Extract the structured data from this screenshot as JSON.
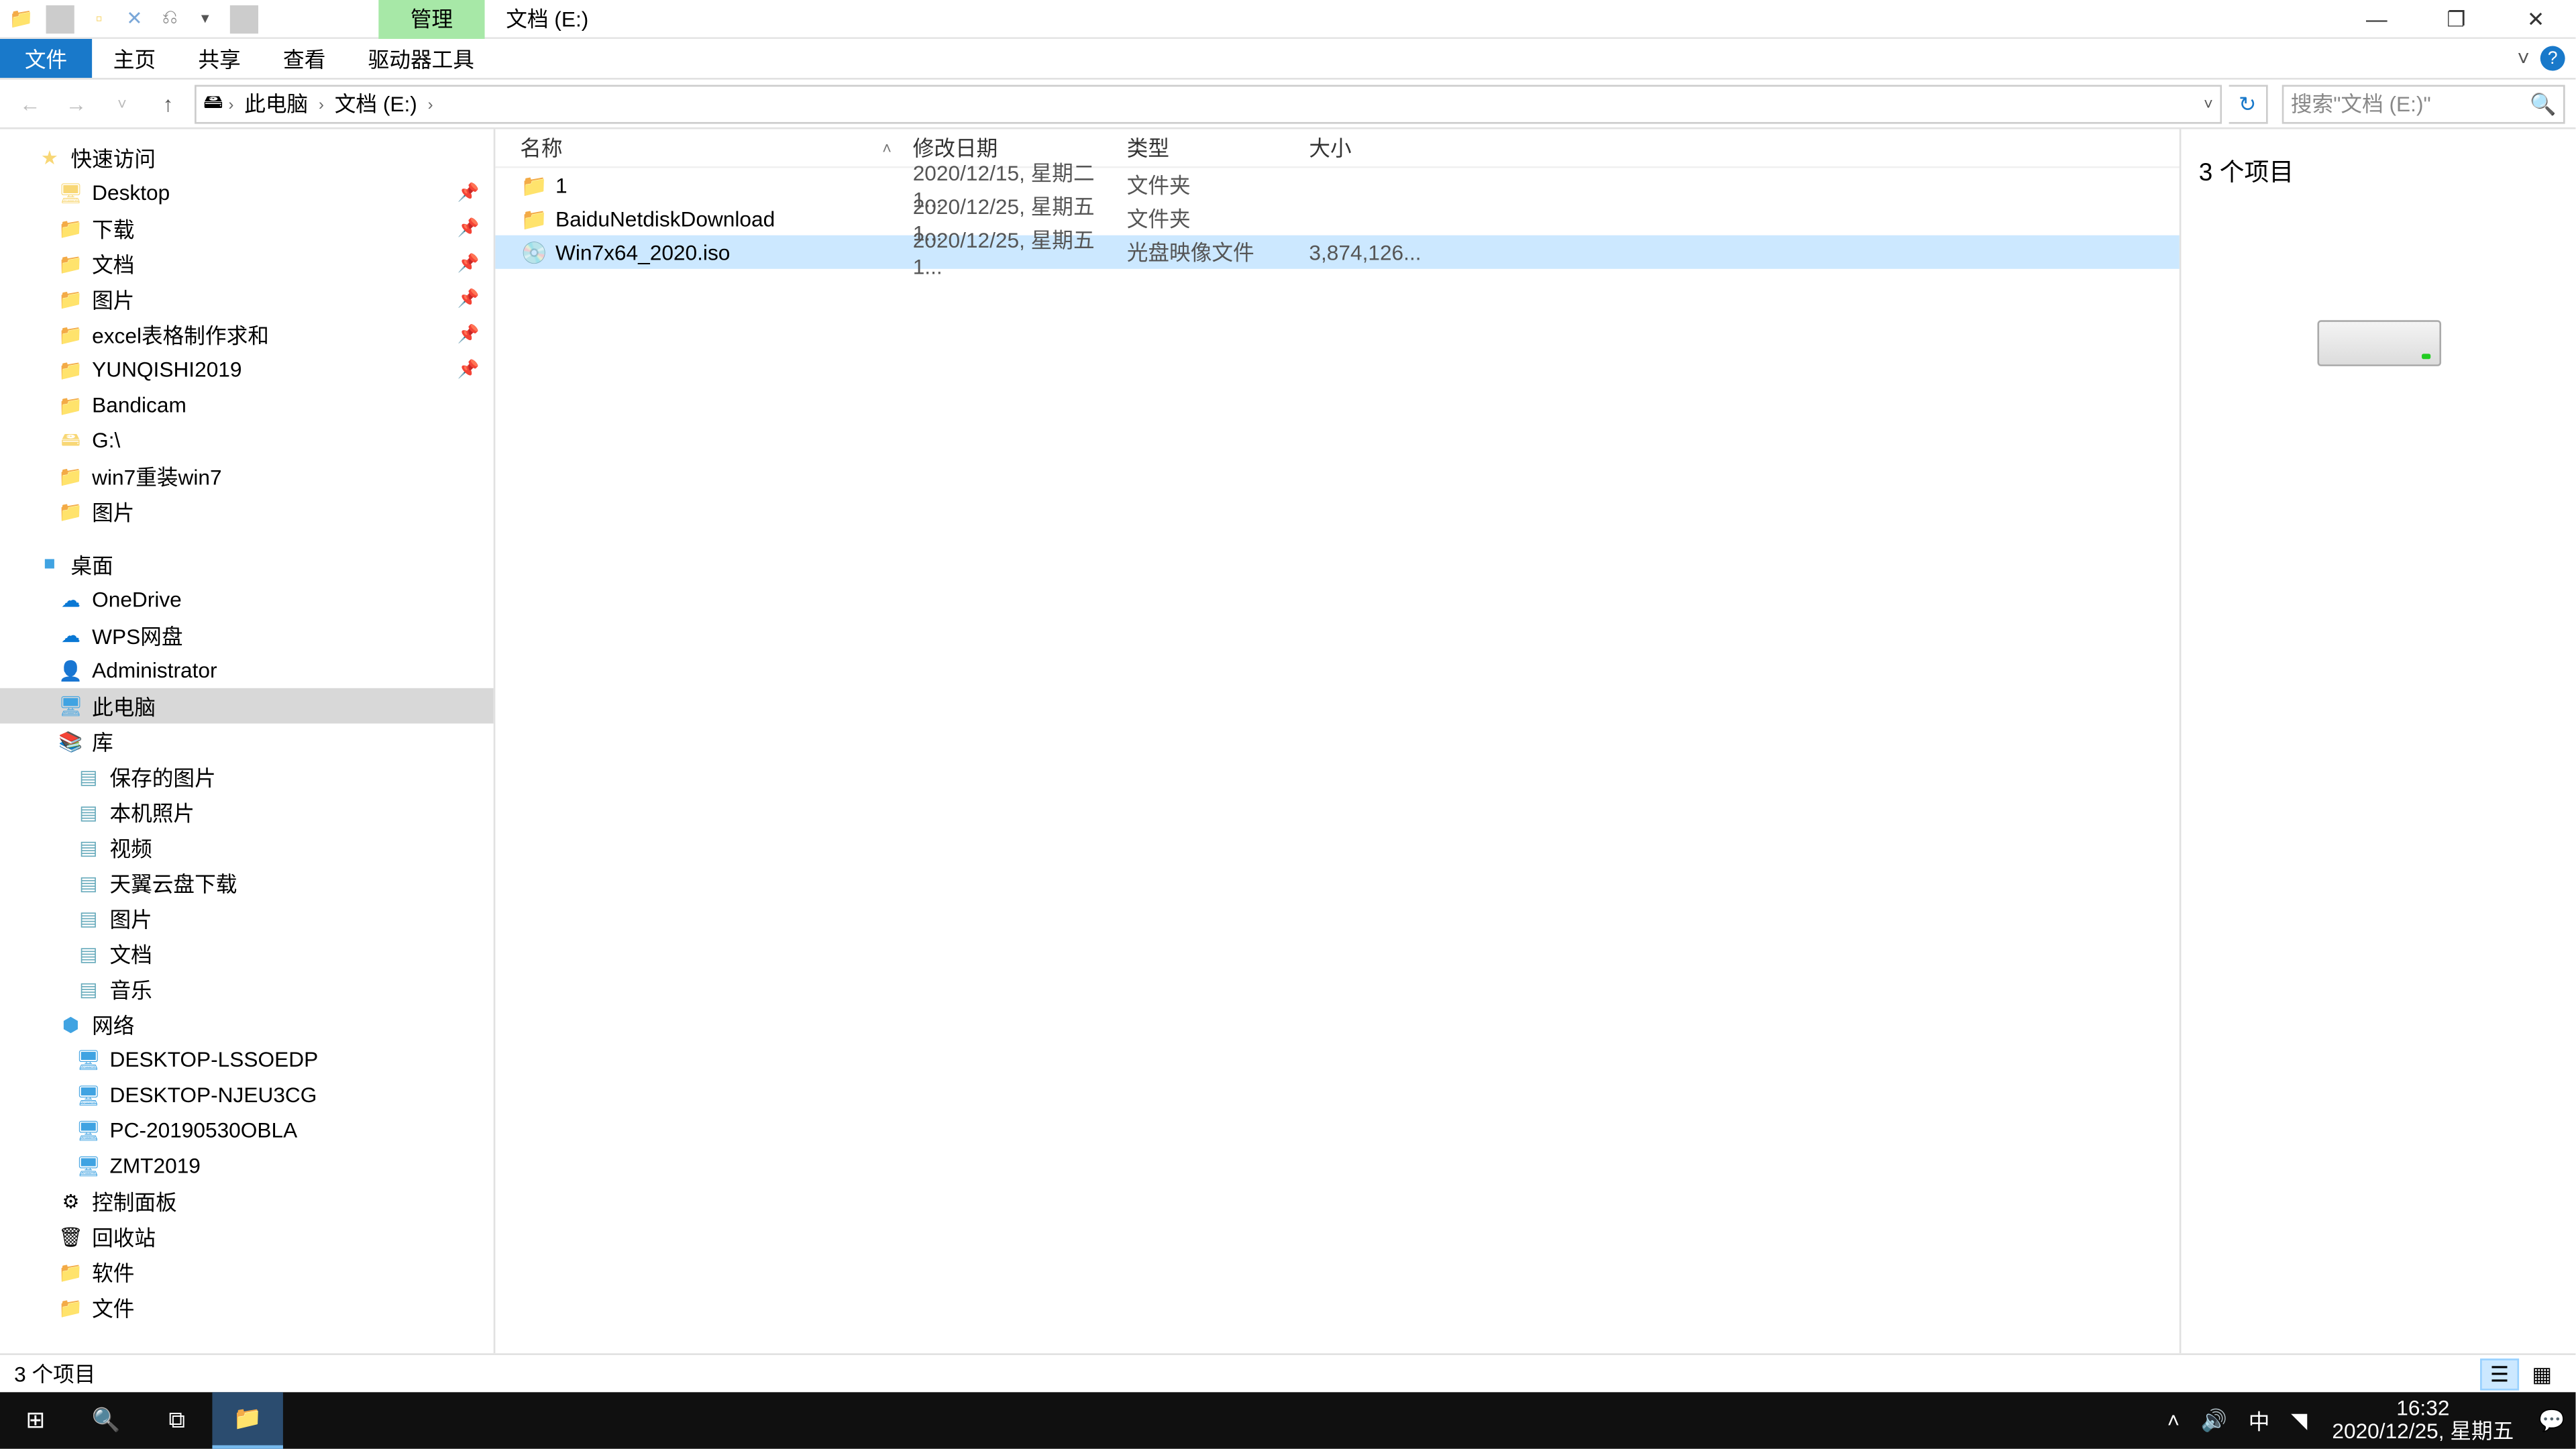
{
  "titlebar": {
    "context_tab": "管理",
    "location_tab": "文档 (E:)"
  },
  "ribbon": {
    "file": "文件",
    "home": "主页",
    "share": "共享",
    "view": "查看",
    "drive_tools": "驱动器工具"
  },
  "addr": {
    "this_pc": "此电脑",
    "drive": "文档 (E:)"
  },
  "search": {
    "placeholder": "搜索\"文档 (E:)\""
  },
  "nav": {
    "quick_access": "快速访问",
    "qa_items": [
      {
        "label": "Desktop",
        "icon": "desktop",
        "pin": true
      },
      {
        "label": "下载",
        "icon": "folder",
        "pin": true
      },
      {
        "label": "文档",
        "icon": "folder",
        "pin": true
      },
      {
        "label": "图片",
        "icon": "folder",
        "pin": true
      },
      {
        "label": "excel表格制作求和",
        "icon": "folder",
        "pin": true
      },
      {
        "label": "YUNQISHI2019",
        "icon": "folder",
        "pin": true
      },
      {
        "label": "Bandicam",
        "icon": "folder",
        "pin": false
      },
      {
        "label": "G:\\",
        "icon": "drive",
        "pin": false
      },
      {
        "label": "win7重装win7",
        "icon": "folder",
        "pin": false
      },
      {
        "label": "图片",
        "icon": "folder",
        "pin": false
      }
    ],
    "desktop": "桌面",
    "desktop_items": [
      {
        "label": "OneDrive",
        "icon": "cloud"
      },
      {
        "label": "WPS网盘",
        "icon": "cloud"
      },
      {
        "label": "Administrator",
        "icon": "user"
      },
      {
        "label": "此电脑",
        "icon": "pc",
        "sel": true
      },
      {
        "label": "库",
        "icon": "lib"
      }
    ],
    "lib_items": [
      {
        "label": "保存的图片"
      },
      {
        "label": "本机照片"
      },
      {
        "label": "视频"
      },
      {
        "label": "天翼云盘下载"
      },
      {
        "label": "图片"
      },
      {
        "label": "文档"
      },
      {
        "label": "音乐"
      }
    ],
    "network": "网络",
    "net_items": [
      {
        "label": "DESKTOP-LSSOEDP"
      },
      {
        "label": "DESKTOP-NJEU3CG"
      },
      {
        "label": "PC-20190530OBLA"
      },
      {
        "label": "ZMT2019"
      }
    ],
    "extra": [
      {
        "label": "控制面板",
        "icon": "cpl"
      },
      {
        "label": "回收站",
        "icon": "bin"
      },
      {
        "label": "软件",
        "icon": "folder"
      },
      {
        "label": "文件",
        "icon": "folder"
      }
    ]
  },
  "columns": {
    "name": "名称",
    "date": "修改日期",
    "type": "类型",
    "size": "大小"
  },
  "files": [
    {
      "name": "1",
      "date": "2020/12/15, 星期二 1...",
      "type": "文件夹",
      "size": "",
      "icon": "folder",
      "sel": false
    },
    {
      "name": "BaiduNetdiskDownload",
      "date": "2020/12/25, 星期五 1...",
      "type": "文件夹",
      "size": "",
      "icon": "folder",
      "sel": false
    },
    {
      "name": "Win7x64_2020.iso",
      "date": "2020/12/25, 星期五 1...",
      "type": "光盘映像文件",
      "size": "3,874,126...",
      "icon": "disc",
      "sel": true
    }
  ],
  "preview": {
    "count": "3 个项目"
  },
  "status": {
    "text": "3 个项目"
  },
  "taskbar": {
    "time": "16:32",
    "date": "2020/12/25, 星期五",
    "ime": "中"
  }
}
